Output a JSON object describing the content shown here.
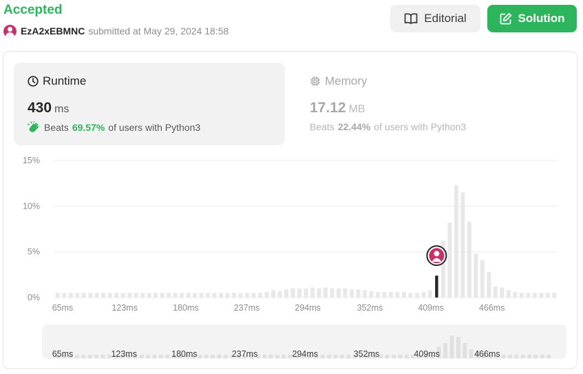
{
  "header": {
    "status": "Accepted",
    "username": "EzA2xEBMNC",
    "submitted_text": "submitted at May 29, 2024 18:58",
    "editorial_label": "Editorial",
    "solution_label": "Solution"
  },
  "runtime": {
    "label": "Runtime",
    "value": "430",
    "unit": "ms",
    "beats_prefix": "Beats",
    "beats_pct": "69.57%",
    "beats_suffix": "of users with Python3"
  },
  "memory": {
    "label": "Memory",
    "value": "17.12",
    "unit": "MB",
    "beats_prefix": "Beats",
    "beats_pct": "22.44%",
    "beats_suffix": "of users with Python3"
  },
  "colors": {
    "accent": "#2db55d",
    "bar": "#e8e8e8",
    "highlight_bar": "#262626",
    "user_avatar": "#c9306a"
  },
  "chart_data": {
    "type": "bar",
    "xlabel": "",
    "ylabel": "",
    "ylim": [
      0,
      15
    ],
    "y_ticks": [
      "0%",
      "5%",
      "10%",
      "15%"
    ],
    "x_tick_labels": [
      "65ms",
      "123ms",
      "180ms",
      "237ms",
      "294ms",
      "352ms",
      "409ms",
      "466ms"
    ],
    "x_range_ms": [
      65,
      535
    ],
    "bin_width_ms": 6.1,
    "grid": true,
    "highlight_ms": 430,
    "values": [
      0.5,
      0.5,
      0.5,
      0.5,
      0.5,
      0.5,
      0.5,
      0.5,
      0.5,
      0.5,
      0.5,
      0.5,
      0.5,
      0.5,
      0.5,
      0.5,
      0.5,
      0.5,
      0.5,
      0.5,
      0.5,
      0.5,
      0.5,
      0.5,
      0.5,
      0.5,
      0.5,
      0.5,
      0.5,
      0.5,
      0.5,
      0.5,
      0.6,
      0.8,
      0.7,
      0.9,
      1.0,
      1.0,
      1.0,
      1.1,
      1.0,
      1.1,
      1.0,
      1.0,
      1.0,
      0.9,
      0.9,
      0.8,
      0.7,
      0.6,
      0.6,
      0.6,
      0.6,
      0.6,
      0.5,
      0.5,
      0.6,
      0.8,
      2.0,
      6.2,
      8.2,
      12.3,
      11.5,
      8.3,
      4.8,
      4.1,
      2.8,
      1.2,
      1.1,
      0.8,
      0.6,
      0.5,
      0.5,
      0.5,
      0.5,
      0.5,
      0.5
    ],
    "highlight_index": 58,
    "highlight_value": 2.4
  }
}
